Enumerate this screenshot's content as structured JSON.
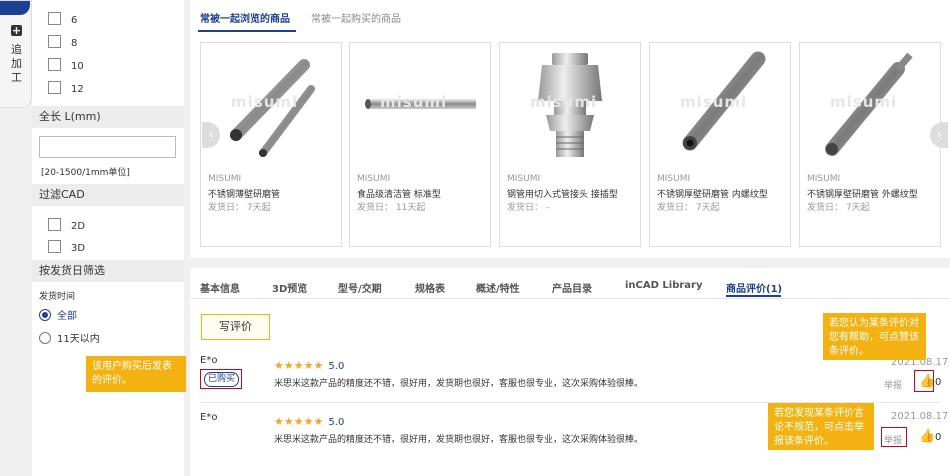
{
  "side_tab": {
    "label": "追加工"
  },
  "filter": {
    "sizes": [
      "6",
      "8",
      "10",
      "12"
    ],
    "length": {
      "title": "全长 L(mm)",
      "hint": "[20-1500/1mm单位]",
      "value": ""
    },
    "cad": {
      "title": "过滤CAD",
      "options": [
        "2D",
        "3D"
      ]
    },
    "ship": {
      "title": "按发货日筛选",
      "subtitle": "发货时间",
      "options": [
        "全部",
        "11天以内"
      ],
      "selected": "全部"
    }
  },
  "products": {
    "tabs": [
      "常被一起浏览的商品",
      "常被一起购买的商品"
    ],
    "active_tab": "常被一起浏览的商品",
    "watermark": "misumi",
    "items": [
      {
        "brand": "MISUMI",
        "name": "不锈钢薄壁研磨管",
        "ship": "发货日： 7天起"
      },
      {
        "brand": "MISUMI",
        "name": "食品级清洁管 标准型",
        "ship": "发货日： 11天起"
      },
      {
        "brand": "MISUMI",
        "name": "钢管用切入式管接头 接插型",
        "ship": "发货日： -"
      },
      {
        "brand": "MISUMI",
        "name": "不锈钢厚壁研磨管 内螺纹型",
        "ship": "发货日： 7天起"
      },
      {
        "brand": "MISUMI",
        "name": "不锈钢厚壁研磨管 外螺纹型",
        "ship": "发货日： 7天起"
      }
    ]
  },
  "review_tabs": [
    "基本信息",
    "3D预览",
    "型号/交期",
    "规格表",
    "概述/特性",
    "产品目录",
    "inCAD Library",
    "商品评价(1)"
  ],
  "active_review_tab": "商品评价(1)",
  "write_review": "写评价",
  "reviews": [
    {
      "user": "E*o",
      "badge": "已购买",
      "rating": "5.0",
      "date": "2021.08.17",
      "text": "米思米这款产品的精度还不错，很好用，发货期也很好，客服也很专业，这次采购体验很棒。",
      "report": "举报",
      "likes": "0"
    },
    {
      "user": "E*o",
      "badge": "",
      "rating": "5.0",
      "date": "2021.08.17",
      "text": "米思米这款产品的精度还不错，很好用，发货期也很好，客服也很专业，这次采购体验很棒。",
      "report": "举报",
      "likes": "0"
    }
  ],
  "tips": {
    "purchased": "该用户购买后发表的评价。",
    "helpful": "若您认为某条评价对您有帮助，可点赞该条评价。",
    "report": "若您发现某条评价言论不规范，可点击举报该条评价。"
  },
  "colors": {
    "brand": "#1d3f94",
    "star": "#f5a623",
    "tip": "#f3b211",
    "highlight": "#d0021b"
  }
}
